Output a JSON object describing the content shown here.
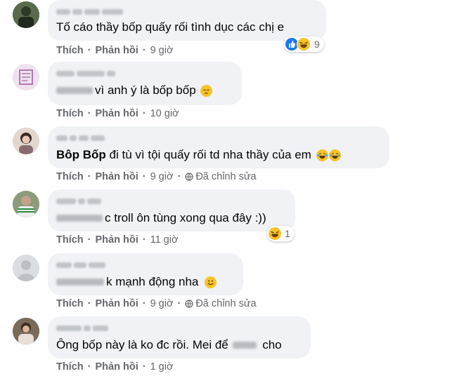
{
  "actions": {
    "like": "Thích",
    "reply": "Phản hồi",
    "edited": "Đã chỉnh sửa"
  },
  "comments": [
    {
      "text": "Tố cáo thầy bốp quấy rối tình dục các chị e",
      "time": "9 giờ",
      "reaction_count": "9",
      "reactions": [
        "like-icon",
        "haha-icon"
      ]
    },
    {
      "text": "vì anh ý là bốp bốp",
      "time": "10 giờ",
      "emoji": "pensive-face-icon"
    },
    {
      "bold": "Bôp Bốp",
      "text": " đi tù vì tội quấy rối td nha thầy của em",
      "time": "9 giờ",
      "edited": true,
      "emoji": "laughing-crying-icon"
    },
    {
      "text": "c troll ôn tùng xong qua đây :))",
      "time": "11 giờ",
      "reaction_count": "1",
      "reactions": [
        "haha-icon"
      ]
    },
    {
      "text": "k mạnh động nha",
      "time": "9 giờ",
      "edited": true,
      "emoji": "smiling-face-icon"
    },
    {
      "text": "Ông bốp này là ko đc rồi. Mei để",
      "text_after": " cho",
      "time": "1 giờ"
    }
  ],
  "colors": {
    "bubble": "#f0f2f5",
    "meta": "#65676b",
    "like_blue": "#1877f2",
    "emoji_yellow": "#f7c22b"
  }
}
